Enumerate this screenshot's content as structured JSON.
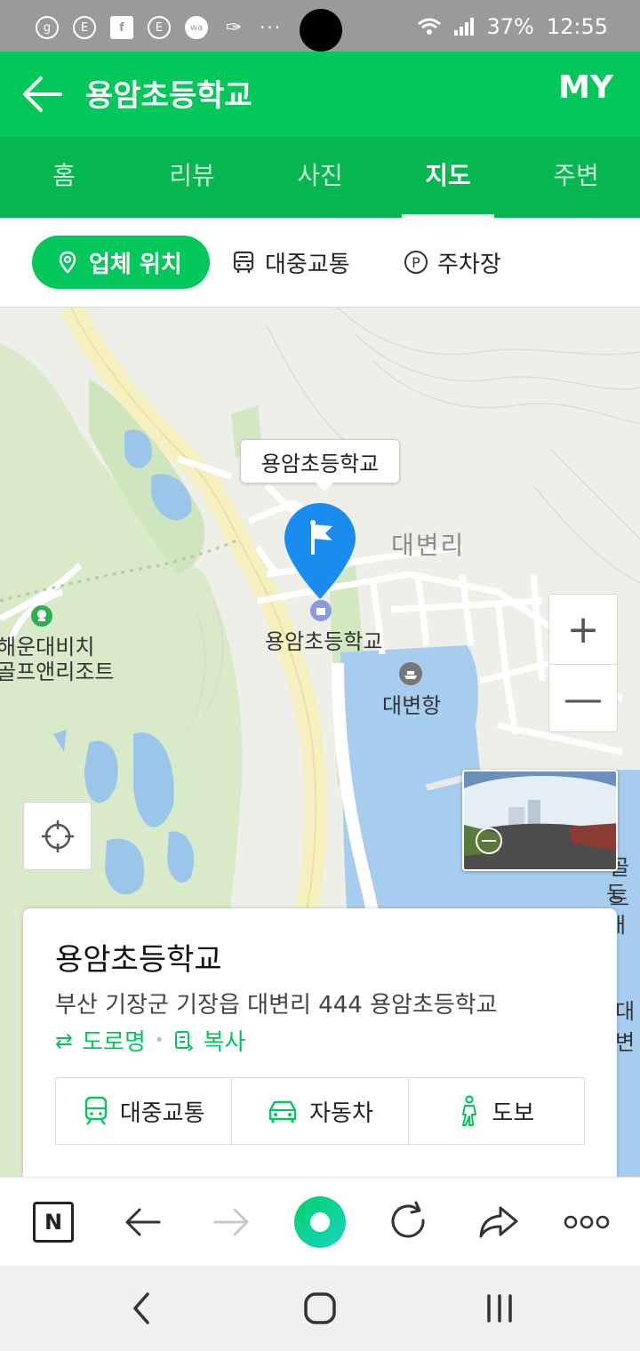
{
  "status_bar": {
    "notification_icons": [
      "g-icon",
      "e-icon",
      "facebook-icon",
      "e-icon",
      "wa-icon",
      "feather-icon"
    ],
    "more": "···",
    "battery": "37%",
    "time": "12:55"
  },
  "header": {
    "back_icon": "arrow-left-icon",
    "title": "용암초등학교",
    "my_label": "MY"
  },
  "tabs": [
    {
      "label": "홈",
      "active": false
    },
    {
      "label": "리뷰",
      "active": false
    },
    {
      "label": "사진",
      "active": false
    },
    {
      "label": "지도",
      "active": true
    },
    {
      "label": "주변",
      "active": false
    }
  ],
  "filters": {
    "location": "업체 위치",
    "transit": "대중교통",
    "parking": "주차장"
  },
  "map": {
    "marker_bubble": "용암초등학교",
    "poi_school": "용암초등학교",
    "region_label": "대변리",
    "port_label": "대변항",
    "golf_line1": "해운대비치",
    "golf_line2": "골프앤리조트",
    "edge_label1": "골드",
    "edge_label2": "등대",
    "edge_label3": "대변",
    "zoom_in": "+",
    "zoom_out": "—"
  },
  "info_card": {
    "title": "용암초등학교",
    "address": "부산 기장군 기장읍 대변리 444 용암초등학교",
    "road_name_link": "도로명",
    "copy_link": "복사",
    "buttons": {
      "transit": "대중교통",
      "car": "자동차",
      "walk": "도보"
    }
  },
  "browser_bar": {
    "icons": [
      "naver-n-icon",
      "back-arrow-icon",
      "forward-arrow-icon",
      "green-dot-icon",
      "refresh-icon",
      "share-icon",
      "more-dots-icon"
    ],
    "n_label": "N"
  },
  "colors": {
    "brand_green": "#03c75a",
    "tab_green": "#06b650",
    "marker_blue": "#1a8cf0"
  }
}
